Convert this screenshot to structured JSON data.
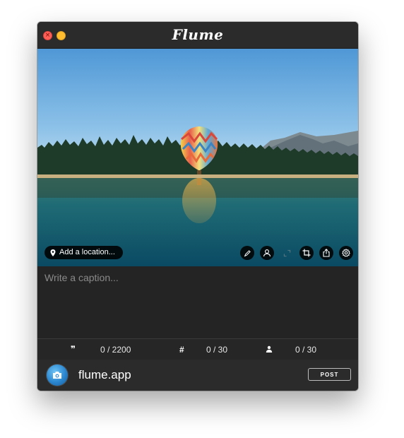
{
  "window": {
    "app_title": "Flume",
    "controls": [
      "close",
      "minimize"
    ]
  },
  "photo": {
    "subject": "hot-air-balloon-over-lake",
    "location_button_label": "Add a location...",
    "location_icon": "location-pin-icon",
    "tools": [
      {
        "name": "edit-pen-icon",
        "enabled": true
      },
      {
        "name": "user-tag-icon",
        "enabled": true
      },
      {
        "name": "resize-icon",
        "enabled": false
      },
      {
        "name": "crop-icon",
        "enabled": true
      },
      {
        "name": "share-icon",
        "enabled": true
      },
      {
        "name": "settings-gear-icon",
        "enabled": true
      }
    ]
  },
  "caption": {
    "placeholder": "Write a caption...",
    "value": ""
  },
  "counters": {
    "characters": {
      "icon": "quote-icon",
      "glyph": "❞",
      "text": "0 / 2200"
    },
    "hashtags": {
      "icon": "hashtag-icon",
      "glyph": "#",
      "text": "0 / 30"
    },
    "mentions": {
      "icon": "person-icon",
      "text": "0 / 30"
    }
  },
  "footer": {
    "account_name": "flume.app",
    "avatar_icon": "camera-icon",
    "post_label": "POST"
  },
  "colors": {
    "window_bg": "#2a2a2a",
    "caption_bg": "#242424",
    "accent_caret": "#4a90e2",
    "close": "#fe5f57",
    "minimize": "#febc2e"
  }
}
